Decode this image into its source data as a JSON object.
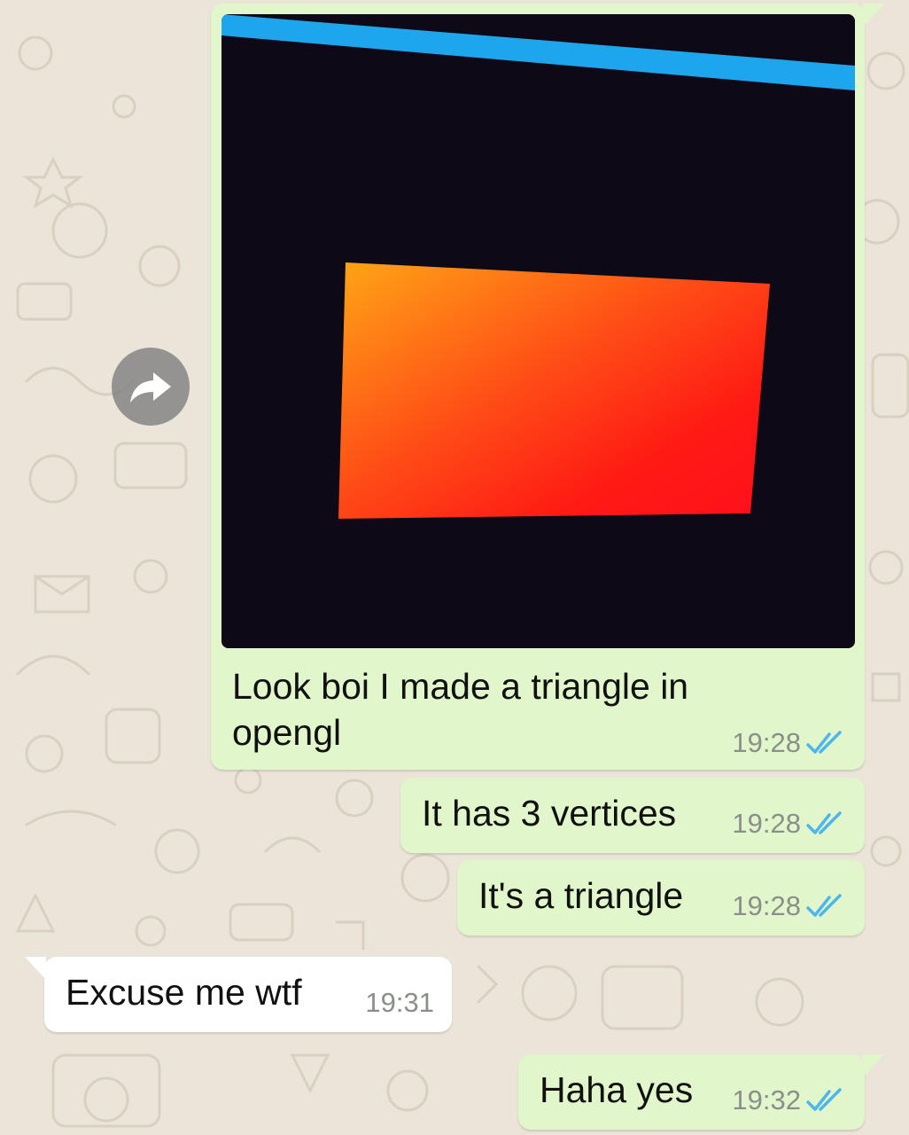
{
  "messages": [
    {
      "id": "m1",
      "direction": "outgoing",
      "type": "image",
      "caption_line1": "Look boi I made a triangle in",
      "caption_line2": "opengl",
      "time": "19:28",
      "status": "read"
    },
    {
      "id": "m2",
      "direction": "outgoing",
      "text": "It has 3 vertices",
      "time": "19:28",
      "status": "read"
    },
    {
      "id": "m3",
      "direction": "outgoing",
      "text": "It's a triangle",
      "time": "19:28",
      "status": "read"
    },
    {
      "id": "m4",
      "direction": "incoming",
      "text": "Excuse me wtf",
      "time": "19:31"
    },
    {
      "id": "m5",
      "direction": "outgoing",
      "text": "Haha yes",
      "time": "19:32",
      "status": "read"
    }
  ],
  "icons": {
    "forward": "forward-arrow-icon",
    "read_receipt": "double-check-icon"
  },
  "colors": {
    "outgoing_bubble": "#e1f7cb",
    "incoming_bubble": "#ffffff",
    "read_tick": "#4fb6ec",
    "wallpaper": "#ebe4d9"
  }
}
